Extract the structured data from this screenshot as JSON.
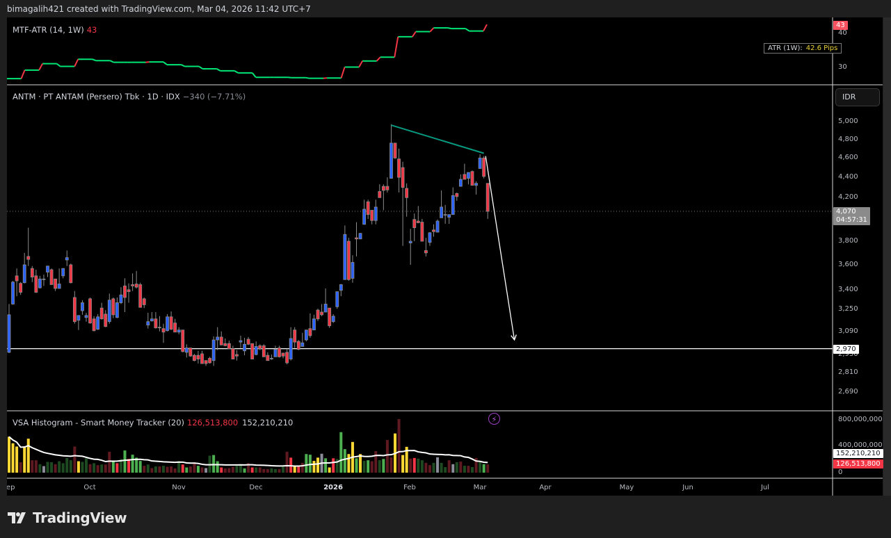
{
  "attribution": "bimagalih421 created with TradingView.com, Mar 04, 2026 11:42 UTC+7",
  "atr_pane": {
    "title": "MTF-ATR (14, 1W)",
    "value": "43",
    "box_label": "ATR (1W):",
    "box_value": "42.6 Pips",
    "axis_ticks": [
      "40",
      "30"
    ],
    "current_tag": "43",
    "weekly_values": [
      26.7,
      29.2,
      31.1,
      30.3,
      32.4,
      32.0,
      31.5,
      31.5,
      31.6,
      30.8,
      30.3,
      29.6,
      29.0,
      28.4,
      27.1,
      27.1,
      27.0,
      26.8,
      26.9,
      30.1,
      31.9,
      33.0,
      39.0,
      40.5,
      41.6,
      41.4,
      40.7,
      42.6
    ],
    "colors": {
      "flat": "#00e676",
      "rise": "#f23645"
    }
  },
  "price_pane": {
    "title": "ANTM · PT ANTAM (Persero) Tbk · 1D · IDX",
    "change": "−340 (−7.71%)",
    "currency_button": "IDR",
    "axis_ticks": [
      "5,000",
      "4,800",
      "4,600",
      "4,400",
      "4,200",
      "3,800",
      "3,600",
      "3,400",
      "3,250",
      "3,090",
      "2,930",
      "2,810",
      "2,690"
    ],
    "axis_tick_values": [
      5000,
      4800,
      4600,
      4400,
      4200,
      3800,
      3600,
      3400,
      3250,
      3090,
      2930,
      2810,
      2690
    ],
    "last_price": "4,070",
    "last_price_value": 4070,
    "countdown": "04:57:31",
    "support_level": "2,970",
    "support_value": 2970,
    "colors": {
      "up": "#2962ff",
      "down": "#f23645",
      "border": "#8c8c8c",
      "trendline": "#089981"
    },
    "trendline": {
      "from_bar": 99,
      "from_price": 4960,
      "to_bar": 123,
      "to_price": 4650
    },
    "arrow": {
      "from_bar": 124,
      "from_price": 4620,
      "to_bar": 132,
      "to_price": 3030
    },
    "candles": [
      [
        2945,
        3290,
        2940,
        3210
      ],
      [
        3290,
        3470,
        3285,
        3460
      ],
      [
        3510,
        3570,
        3350,
        3470
      ],
      [
        3450,
        3460,
        3360,
        3380
      ],
      [
        3455,
        3700,
        3450,
        3600
      ],
      [
        3670,
        3920,
        3590,
        3645
      ],
      [
        3570,
        3590,
        3460,
        3500
      ],
      [
        3510,
        3560,
        3375,
        3380
      ],
      [
        3415,
        3510,
        3410,
        3485
      ],
      [
        3485,
        3520,
        3430,
        3485
      ],
      [
        3540,
        3590,
        3500,
        3590
      ],
      [
        3560,
        3570,
        3440,
        3440
      ],
      [
        3485,
        3485,
        3390,
        3410
      ],
      [
        3410,
        3570,
        3410,
        3445
      ],
      [
        3510,
        3570,
        3490,
        3570
      ],
      [
        3640,
        3720,
        3590,
        3660
      ],
      [
        3600,
        3610,
        3450,
        3455
      ],
      [
        3340,
        3390,
        3145,
        3160
      ],
      [
        3170,
        3205,
        3100,
        3205
      ],
      [
        3240,
        3320,
        3210,
        3300
      ],
      [
        3190,
        3225,
        3160,
        3205
      ],
      [
        3330,
        3340,
        3145,
        3150
      ],
      [
        3180,
        3200,
        3090,
        3095
      ],
      [
        3105,
        3215,
        3100,
        3195
      ],
      [
        3260,
        3300,
        3175,
        3180
      ],
      [
        3215,
        3245,
        3120,
        3125
      ],
      [
        3160,
        3370,
        3145,
        3320
      ],
      [
        3330,
        3340,
        3185,
        3210
      ],
      [
        3190,
        3340,
        3185,
        3300
      ],
      [
        3300,
        3420,
        3290,
        3360
      ],
      [
        3430,
        3490,
        3230,
        3340
      ],
      [
        3400,
        3450,
        3300,
        3385
      ],
      [
        3440,
        3530,
        3390,
        3430
      ],
      [
        3445,
        3550,
        3410,
        3420
      ],
      [
        3440,
        3455,
        3265,
        3265
      ],
      [
        3330,
        3340,
        3260,
        3285
      ],
      [
        3135,
        3225,
        3110,
        3160
      ],
      [
        3165,
        3230,
        3160,
        3180
      ],
      [
        3180,
        3230,
        3110,
        3115
      ],
      [
        3120,
        3200,
        3090,
        3115
      ],
      [
        3110,
        3145,
        3010,
        3085
      ],
      [
        3095,
        3215,
        3090,
        3195
      ],
      [
        3195,
        3235,
        3100,
        3105
      ],
      [
        3150,
        3180,
        3085,
        3085
      ],
      [
        3085,
        3120,
        3070,
        3100
      ],
      [
        3100,
        3100,
        2945,
        2950
      ],
      [
        2945,
        3000,
        2910,
        2975
      ],
      [
        2975,
        2975,
        2915,
        2920
      ],
      [
        2925,
        2935,
        2885,
        2890
      ],
      [
        2925,
        2955,
        2870,
        2900
      ],
      [
        2935,
        2955,
        2870,
        2870
      ],
      [
        2890,
        2890,
        2855,
        2870
      ],
      [
        2905,
        2915,
        2870,
        2875
      ],
      [
        2890,
        3055,
        2855,
        3030
      ],
      [
        3030,
        3120,
        2960,
        3050
      ],
      [
        3050,
        3090,
        2995,
        2995
      ],
      [
        3005,
        3040,
        2990,
        2990
      ],
      [
        3005,
        3025,
        2970,
        2970
      ],
      [
        2970,
        2990,
        2900,
        2900
      ],
      [
        2930,
        2960,
        2890,
        2920
      ],
      [
        3015,
        3060,
        2975,
        3025
      ],
      [
        2955,
        3045,
        2925,
        3000
      ],
      [
        3035,
        3050,
        2995,
        3000
      ],
      [
        3005,
        3005,
        2900,
        2900
      ],
      [
        2930,
        3020,
        2925,
        2985
      ],
      [
        2990,
        3000,
        2960,
        2970
      ],
      [
        2990,
        3000,
        2915,
        2915
      ],
      [
        2925,
        2945,
        2890,
        2890
      ],
      [
        2905,
        2930,
        2895,
        2905
      ],
      [
        2915,
        2990,
        2915,
        2965
      ],
      [
        2975,
        2990,
        2910,
        2915
      ],
      [
        2940,
        2940,
        2905,
        2920
      ],
      [
        2945,
        2970,
        2865,
        2875
      ],
      [
        2900,
        3120,
        2890,
        3040
      ],
      [
        3100,
        3120,
        2975,
        3015
      ],
      [
        3020,
        3030,
        2960,
        2965
      ],
      [
        2985,
        3080,
        2985,
        3010
      ],
      [
        3030,
        3100,
        3020,
        3100
      ],
      [
        3110,
        3220,
        3045,
        3060
      ],
      [
        3100,
        3210,
        3100,
        3180
      ],
      [
        3245,
        3255,
        3165,
        3180
      ],
      [
        3230,
        3290,
        3200,
        3210
      ],
      [
        3230,
        3410,
        3230,
        3290
      ],
      [
        3260,
        3260,
        3115,
        3130
      ],
      [
        3160,
        3215,
        3150,
        3200
      ],
      [
        3270,
        3385,
        3255,
        3385
      ],
      [
        3395,
        3445,
        3350,
        3440
      ],
      [
        3480,
        3940,
        3480,
        3860
      ],
      [
        3800,
        3830,
        3470,
        3480
      ],
      [
        3490,
        3680,
        3455,
        3620
      ],
      [
        3830,
        3970,
        3670,
        3820
      ],
      [
        3820,
        3870,
        3820,
        3870
      ],
      [
        3950,
        4180,
        3950,
        4090
      ],
      [
        4160,
        4180,
        4000,
        4040
      ],
      [
        4080,
        4080,
        3950,
        3985
      ],
      [
        3985,
        4180,
        3950,
        4110
      ],
      [
        4260,
        4330,
        4200,
        4200
      ],
      [
        4310,
        4330,
        4080,
        4270
      ],
      [
        4310,
        4400,
        4250,
        4275
      ],
      [
        4390,
        4970,
        4390,
        4760
      ],
      [
        4760,
        4760,
        4590,
        4600
      ],
      [
        4590,
        4700,
        4250,
        4400
      ],
      [
        4500,
        4560,
        3760,
        4300
      ],
      [
        4290,
        4340,
        4020,
        4200
      ],
      [
        3785,
        3910,
        3600,
        3800
      ],
      [
        3995,
        4050,
        3800,
        3920
      ],
      [
        3980,
        4120,
        3960,
        3965
      ],
      [
        3970,
        4000,
        3800,
        3800
      ],
      [
        3720,
        3830,
        3670,
        3700
      ],
      [
        3790,
        3880,
        3760,
        3875
      ],
      [
        3900,
        3950,
        3840,
        3885
      ],
      [
        3880,
        3995,
        3880,
        3980
      ],
      [
        4010,
        4270,
        4010,
        4110
      ],
      [
        4040,
        4130,
        3955,
        4040
      ],
      [
        4015,
        4040,
        3955,
        4040
      ],
      [
        4040,
        4300,
        4040,
        4220
      ],
      [
        4240,
        4250,
        4170,
        4210
      ],
      [
        4310,
        4430,
        4310,
        4380
      ],
      [
        4430,
        4540,
        4380,
        4380
      ],
      [
        4390,
        4450,
        4330,
        4450
      ],
      [
        4460,
        4470,
        4320,
        4320
      ],
      [
        4320,
        4360,
        4230,
        4340
      ],
      [
        4490,
        4640,
        4490,
        4600
      ],
      [
        4600,
        4620,
        4390,
        4410
      ],
      [
        4340,
        4340,
        4000,
        4070
      ]
    ]
  },
  "volume_pane": {
    "title": "VSA Histogram - Smart Money Tracker (20)",
    "value_current": "126,513,800",
    "value_ma": "152,210,210",
    "axis_ticks": [
      "800,000,000",
      "400,000,000",
      "0"
    ],
    "axis_tick_values": [
      800,
      400,
      0
    ],
    "color_map": {
      "Y": "#fdd835",
      "G": "#4caf50",
      "g": "#1e4a22",
      "R": "#f23645",
      "r": "#5e1a20",
      "N": "#8a8d99"
    },
    "volumes_millions": [
      550,
      450,
      400,
      160,
      400,
      520,
      190,
      190,
      130,
      100,
      165,
      160,
      130,
      175,
      145,
      225,
      190,
      400,
      175,
      165,
      220,
      130,
      145,
      115,
      125,
      125,
      320,
      170,
      145,
      210,
      340,
      210,
      275,
      230,
      180,
      105,
      125,
      70,
      95,
      95,
      105,
      90,
      95,
      65,
      180,
      125,
      80,
      95,
      160,
      105,
      80,
      70,
      260,
      270,
      175,
      80,
      65,
      70,
      90,
      105,
      125,
      65,
      145,
      80,
      80,
      80,
      55,
      55,
      65,
      55,
      55,
      95,
      320,
      230,
      95,
      95,
      150,
      285,
      275,
      180,
      230,
      290,
      220,
      80,
      220,
      210,
      620,
      360,
      285,
      470,
      220,
      285,
      180,
      190,
      175,
      330,
      190,
      210,
      500,
      235,
      600,
      820,
      270,
      395,
      215,
      225,
      215,
      190,
      150,
      115,
      150,
      235,
      150,
      85,
      190,
      130,
      160,
      170,
      105,
      105,
      85,
      225,
      160,
      130,
      126.5
    ],
    "volume_colors": "YYYrYYrrgNggrggggrYggrgrgrrGRgGRGGGrgrgrgrrrgRGrrGrNgGGRrrrggGrRgrrrggrgrRYRrGGYYNGYRgGGYYGYgGrrgGrrYrYYrRggrrgNggrNgrgrgrgGrrr",
    "ma_period": 20
  },
  "time_axis": [
    "Sep",
    "Oct",
    "Nov",
    "Dec",
    "2026",
    "Feb",
    "Mar",
    "Apr",
    "May",
    "Jun",
    "Jul"
  ],
  "brand": "TradingView"
}
